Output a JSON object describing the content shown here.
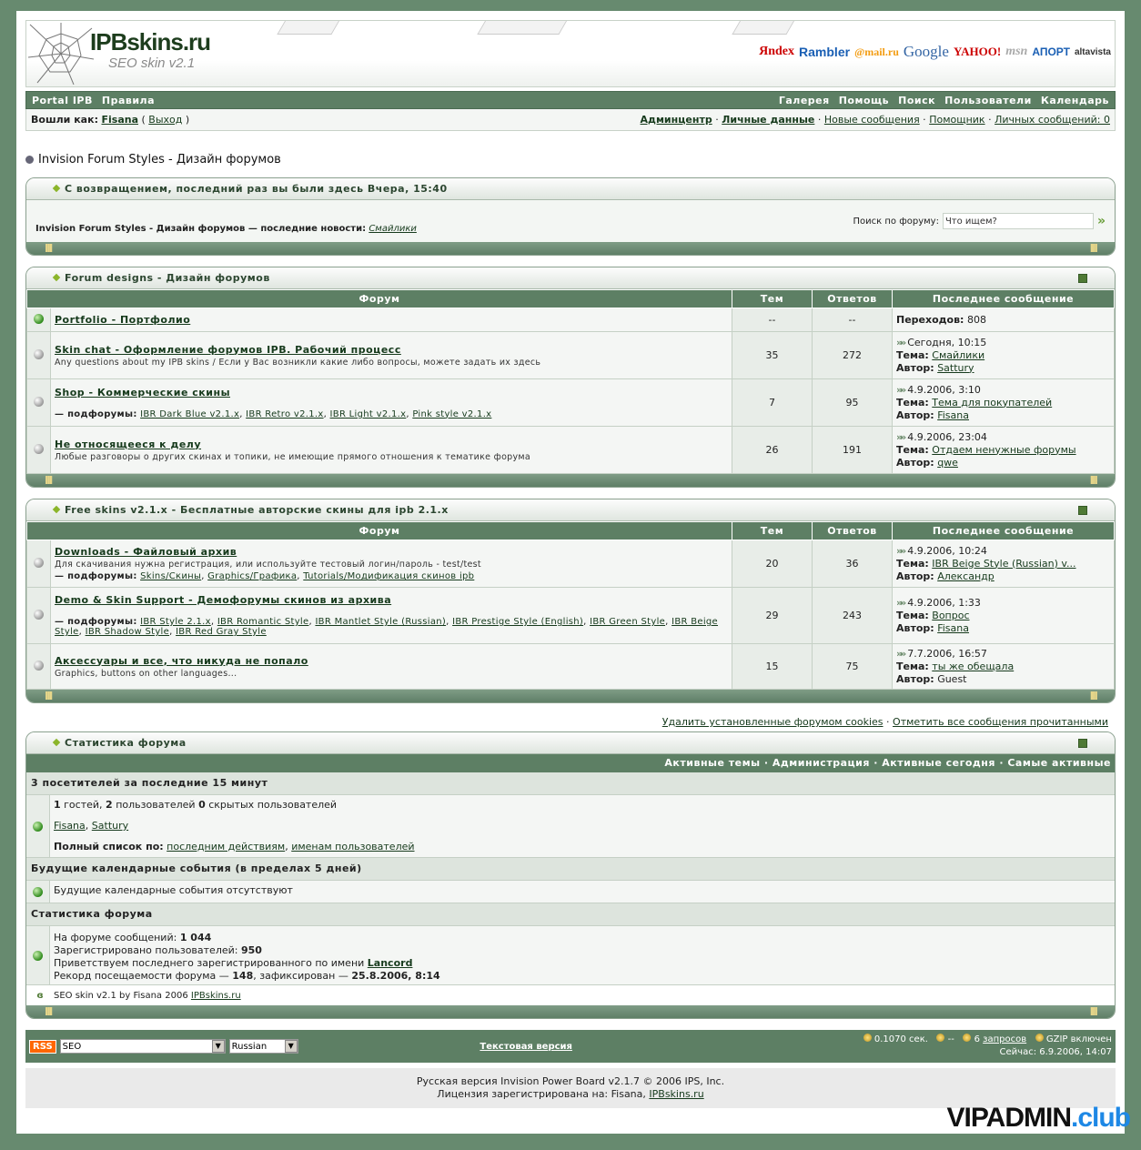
{
  "header": {
    "logo": "IPBskins.ru",
    "subtitle": "SEO skin v2.1",
    "engines": [
      "Яndex",
      "Rambler",
      "@mail.ru",
      "Google",
      "YAHOO!",
      "msn",
      "АПОРТ",
      "altavista"
    ]
  },
  "nav": {
    "left": [
      "Portal IPB",
      "Правила"
    ],
    "right": [
      "Галерея",
      "Помощь",
      "Поиск",
      "Пользователи",
      "Календарь"
    ]
  },
  "user": {
    "label": "Вошли как:",
    "name": "Fisana",
    "logout": "Выход",
    "links": [
      "Админцентр",
      "Личные данные",
      "Новые сообщения",
      "Помощник",
      "Личных сообщений: 0"
    ]
  },
  "breadcrumb": "Invision Forum Styles - Дизайн форумов",
  "welcome": {
    "title": "С возвращением, последний раз вы были здесь Вчера, 15:40",
    "news_prefix": "Invision Forum Styles - Дизайн форумов — последние новости:",
    "news_link": "Смайлики",
    "search_label": "Поиск по форуму:",
    "search_placeholder": "Что ищем?"
  },
  "columns": {
    "forum": "Форум",
    "topics": "Тем",
    "replies": "Ответов",
    "last": "Последнее сообщение"
  },
  "labels": {
    "topic": "Тема:",
    "author": "Автор:",
    "subforums": "— подфорумы:",
    "redirects": "Переходов:"
  },
  "cat1": {
    "title": "Forum designs - Дизайн форумов",
    "rows": [
      {
        "name": "Portfolio - Портфолио",
        "desc": "",
        "subs": [],
        "topics": "--",
        "replies": "--",
        "redirect": "808"
      },
      {
        "name": "Skin chat - Оформление форумов IPB. Рабочий процесс",
        "desc": "Any questions about my IPB skins / Если у Вас возникли какие либо вопросы, можете задать их здесь",
        "subs": [],
        "topics": "35",
        "replies": "272",
        "date": "Сегодня, 10:15",
        "topic": "Смайлики",
        "author": "Sattury"
      },
      {
        "name": "Shop - Коммерческие скины",
        "desc": "",
        "subs": [
          "IBR Dark Blue v2.1.x",
          "IBR Retro v2.1.x",
          "IBR Light v2.1.x",
          "Pink style v2.1.x"
        ],
        "topics": "7",
        "replies": "95",
        "date": "4.9.2006, 3:10",
        "topic": "Тема для покупателей",
        "author": "Fisana"
      },
      {
        "name": "Не относящееся к делу",
        "desc": "Любые разговоры о других скинах и топики, не имеющие прямого отношения к тематике форума",
        "subs": [],
        "topics": "26",
        "replies": "191",
        "date": "4.9.2006, 23:04",
        "topic": "Отдаем ненужные форумы",
        "author": "qwe"
      }
    ]
  },
  "cat2": {
    "title": "Free skins v2.1.x - Бесплатные авторские скины для ipb 2.1.x",
    "rows": [
      {
        "name": "Downloads - Файловый архив",
        "desc": "Для скачивания нужна регистрация, или используйте тестовый логин/пароль - test/test",
        "subs": [
          "Skins/Скины",
          "Graphics/Графика",
          "Tutorials/Модификация скинов ipb"
        ],
        "topics": "20",
        "replies": "36",
        "date": "4.9.2006, 10:24",
        "topic": "IBR Beige Style (Russian) v...",
        "author": "Александр"
      },
      {
        "name": "Demo & Skin Support - Демофорумы скинов из архива",
        "desc": "",
        "subs": [
          "IBR Style 2.1.x",
          "IBR Romantic Style",
          "IBR Mantlet Style (Russian)",
          "IBR Prestige Style (English)",
          "IBR Green Style",
          "IBR Beige Style",
          "IBR Shadow Style",
          "IBR Red Gray Style"
        ],
        "topics": "29",
        "replies": "243",
        "date": "4.9.2006, 1:33",
        "topic": "Вопрос",
        "author": "Fisana"
      },
      {
        "name": "Аксессуары и все, что никуда не попало",
        "desc": "Graphics, buttons on other languages...",
        "subs": [],
        "topics": "15",
        "replies": "75",
        "date": "7.7.2006, 16:57",
        "topic": "ты же обещала",
        "author": "Guest",
        "author_plain": true
      }
    ]
  },
  "tools": {
    "delete_cookies": "Удалить установленные форумом cookies",
    "mark_read": "Отметить все сообщения прочитанными"
  },
  "stats": {
    "title": "Статистика форума",
    "nav": [
      "Активные темы",
      "Администрация",
      "Активные сегодня",
      "Самые активные"
    ],
    "online_head": "3 посетителей за последние 15 минут",
    "guests": "1",
    "guests_t": "гостей,",
    "users": "2",
    "users_t": "пользователей",
    "hidden": "0",
    "hidden_t": "скрытых пользователей",
    "online_users": [
      "Fisana",
      "Sattury"
    ],
    "full_list": "Полный список по:",
    "by_last": "последним действиям",
    "by_name": "именам пользователей",
    "cal_head": "Будущие календарные события (в пределах 5 дней)",
    "cal_none": "Будущие календарные события отсутствуют",
    "st_head": "Статистика форума",
    "posts_t": "На форуме сообщений:",
    "posts": "1 044",
    "reg_t": "Зарегистрировано пользователей:",
    "reg": "950",
    "newest_t": "Приветствуем последнего зарегистрированного по имени",
    "newest": "Lancord",
    "record_t": "Рекорд посещаемости форума —",
    "record": "148",
    "record_t2": ", зафиксирован —",
    "record_date": "25.8.2006, 8:14",
    "credit": "SEO skin v2.1 by Fisana 2006",
    "credit_link": "IPBskins.ru"
  },
  "bottom": {
    "rss": "RSS",
    "skin": "SEO",
    "lang": "Russian",
    "text_version": "Текстовая версия",
    "time": "0.1070 сек.",
    "dash": "--",
    "q_num": "6",
    "q_link": "запросов",
    "gzip": "GZIP включен",
    "now": "Сейчас: 6.9.2006, 14:07"
  },
  "footer": {
    "line1": "Русская версия Invision Power Board v2.1.7 © 2006  IPS, Inc.",
    "line2": "Лицензия зарегистрирована на: Fisana,",
    "line2_link": "IPBskins.ru"
  },
  "watermark": {
    "a": "VIPADMIN",
    "b": ".club"
  },
  "colors": {
    "brand": "#5d7f64",
    "bg": "#678a6f"
  }
}
